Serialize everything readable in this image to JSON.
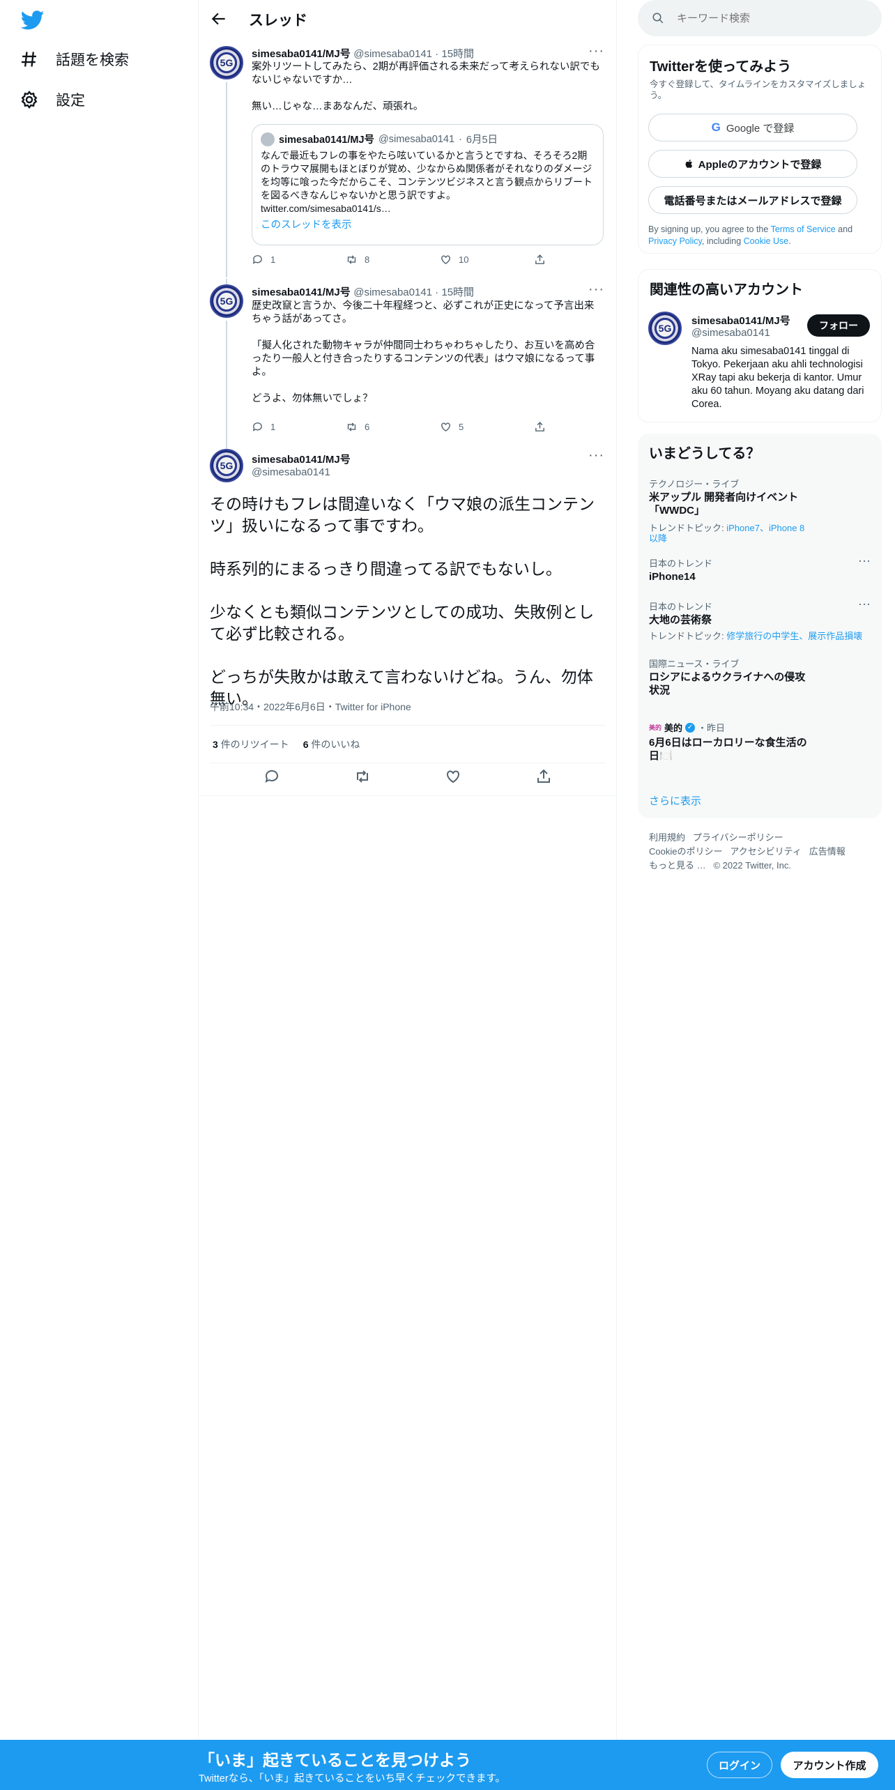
{
  "nav": {
    "explore_label": "話題を検索",
    "settings_label": "設定"
  },
  "header": {
    "title": "スレッド"
  },
  "tweets": [
    {
      "name": "simesaba0141/MJ号",
      "handle": "@simesaba0141",
      "time": "15時間",
      "text": "案外リツートしてみたら、2期が再評価される未来だって考えられない訳でもないじゃないですか…\n\n無い…じゃな…まあなんだ、頑張れ。",
      "quote": {
        "name": "simesaba0141/MJ号",
        "handle": "@simesaba0141",
        "time": "6月5日",
        "text": "なんで最近もフレの事をやたら呟いているかと言うとですね、そろそろ2期のトラウマ展開もほとぼりが覚め、少なからぬ関係者がそれなりのダメージを均等に喰った今だからこそ、コンテンツビジネスと言う観点からリブートを図るべきなんじゃないかと思う訳ですよ。\ntwitter.com/simesaba0141/s…",
        "show_thread": "このスレッドを表示"
      },
      "replies": "1",
      "retweets": "8",
      "likes": "10"
    },
    {
      "name": "simesaba0141/MJ号",
      "handle": "@simesaba0141",
      "time": "15時間",
      "text": "歴史改竄と言うか、今後二十年程経つと、必ずこれが正史になって予言出来ちゃう話があってさ。\n\n「擬人化された動物キャラが仲間同士わちゃわちゃしたり、お互いを高め合ったり一般人と付き合ったりするコンテンツの代表」はウマ娘になるって事よ。\n\nどうよ、勿体無いでしょ？",
      "replies": "1",
      "retweets": "6",
      "likes": "5"
    }
  ],
  "main_tweet": {
    "name": "simesaba0141/MJ号",
    "handle": "@simesaba0141",
    "text": "その時けもフレは間違いなく「ウマ娘の派生コンテンツ」扱いになるって事ですわ。\n\n時系列的にまるっきり間違ってる訳でもないし。\n\n少なくとも類似コンテンツとしての成功、失敗例として必ず比較される。\n\nどっちが失敗かは敢えて言わないけどね。うん、勿体無い。",
    "timestamp": "午前10:34・2022年6月6日・Twitter for iPhone",
    "retweets_count": "3",
    "retweets_label": "件のリツイート",
    "likes_count": "6",
    "likes_label": "件のいいね"
  },
  "search": {
    "placeholder": "キーワード検索"
  },
  "signup": {
    "title": "Twitterを使ってみよう",
    "subtitle": "今すぐ登録して、タイムラインをカスタマイズしましょう。",
    "google": "Google で登録",
    "apple": "Appleのアカウントで登録",
    "phone": "電話番号またはメールアドレスで登録",
    "terms_prefix": "By signing up, you agree to the ",
    "terms": "Terms of Service",
    "and": " and ",
    "privacy": "Privacy Policy",
    "including": ", including ",
    "cookie": "Cookie Use",
    "period": "."
  },
  "related": {
    "title": "関連性の高いアカウント",
    "name": "simesaba0141/MJ号",
    "handle": "@simesaba0141",
    "follow": "フォロー",
    "bio": "Nama aku simesaba0141 tinggal di Tokyo. Pekerjaan aku ahli technologisi XRay tapi aku bekerja di kantor. Umur aku 60 tahun. Moyang aku datang dari Corea."
  },
  "trends": {
    "title": "いまどうしてる？",
    "items": [
      {
        "category": "テクノロジー・ライブ",
        "title": "米アップル 開発者向けイベント「WWDC」",
        "sub_prefix": "トレンドトピック: ",
        "sub_links": "iPhone7、iPhone 8以降"
      },
      {
        "category": "日本のトレンド",
        "title": "iPhone14"
      },
      {
        "category": "日本のトレンド",
        "title": "大地の芸術祭",
        "sub_prefix": "トレンドトピック: ",
        "sub_links": "修学旅行の中学生、展示作品損壊"
      },
      {
        "category": "国際ニュース・ライブ",
        "title": "ロシアによるウクライナへの侵攻状況"
      },
      {
        "category_name": "美的",
        "category_time": "・昨日",
        "title": "6月6日はローカロリーな食生活の日🍽️"
      }
    ],
    "show_more": "さらに表示"
  },
  "footer": {
    "terms": "利用規約",
    "privacy": "プライバシーポリシー",
    "cookie": "Cookieのポリシー",
    "accessibility": "アクセシビリティ",
    "ads": "広告情報",
    "more": "もっと見る …",
    "copyright": "© 2022 Twitter, Inc."
  },
  "bottom": {
    "title": "「いま」起きていることを見つけよう",
    "subtitle": "Twitterなら、「いま」起きていることをいち早くチェックできます。",
    "login": "ログイン",
    "signup": "アカウント作成"
  },
  "avatar_text": "5G",
  "colors": {
    "accent": "#1d9bf0",
    "text": "#0f1419",
    "secondary": "#536471"
  }
}
